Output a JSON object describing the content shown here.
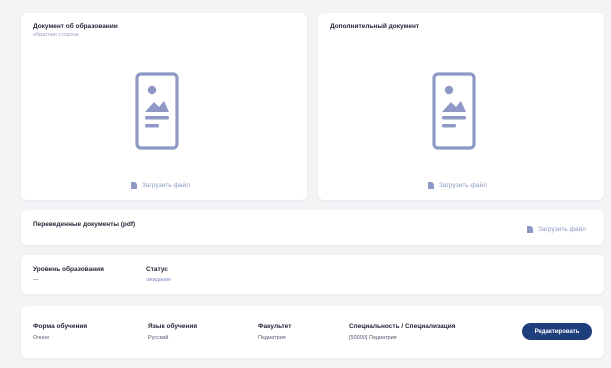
{
  "education_document": {
    "title": "Документ об образовании",
    "subtitle": "обратная сторона",
    "icon": "image-document-icon",
    "upload_label": "Загрузить файл"
  },
  "additional_document": {
    "title": "Дополнительный документ",
    "icon": "image-document-icon",
    "upload_label": "Загрузить файл"
  },
  "translated_documents": {
    "title": "Переведенные документы (pdf)",
    "upload_label": "Загрузить файл"
  },
  "education_level": {
    "label": "Уровень образования",
    "value": "—",
    "status_label": "Статус",
    "status_value": "ожидание"
  },
  "study_info": {
    "form_label": "Форма обучения",
    "form_value": "Очное",
    "language_label": "Язык обучения",
    "language_value": "Русский",
    "faculty_label": "Факультет",
    "faculty_value": "Педиатрия",
    "specialty_label": "Специальность / Специализация",
    "specialty_value": "[50000] Педиатрия",
    "edit_label": "Редактировать"
  },
  "colors": {
    "icon_accent": "#8e99c6",
    "button_bg": "#1f3e7e",
    "page_bg": "#f3f4f6"
  }
}
